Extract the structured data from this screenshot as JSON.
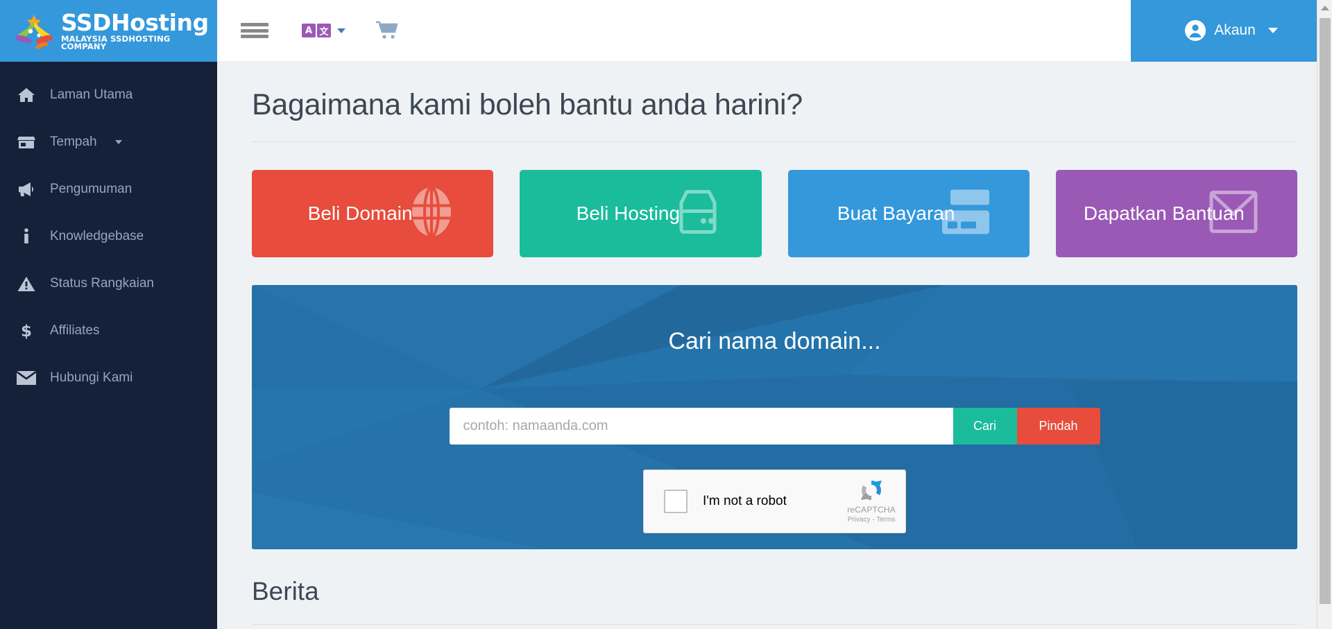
{
  "brand": {
    "name": "SSDHosting",
    "tagline": "MALAYSIA SSDHOSTING COMPANY",
    "logo_icon": "star-burst-logo-icon",
    "header_color": "#3498db"
  },
  "sidebar": {
    "background_color": "#152039",
    "items": [
      {
        "label": "Laman Utama",
        "icon": "home-icon",
        "has_caret": false
      },
      {
        "label": "Tempah",
        "icon": "store-icon",
        "has_caret": true
      },
      {
        "label": "Pengumuman",
        "icon": "megaphone-icon",
        "has_caret": false
      },
      {
        "label": "Knowledgebase",
        "icon": "info-icon",
        "has_caret": false
      },
      {
        "label": "Status Rangkaian",
        "icon": "warning-icon",
        "has_caret": false
      },
      {
        "label": "Affiliates",
        "icon": "dollar-icon",
        "has_caret": false
      },
      {
        "label": "Hubungi Kami",
        "icon": "envelope-icon",
        "has_caret": false
      }
    ]
  },
  "topbar": {
    "menu_toggle_icon": "hamburger-icon",
    "language_icon": "translate-icon",
    "language_glyph_left": "A",
    "language_glyph_right": "文",
    "cart_icon": "shopping-cart-icon",
    "account_label": "Akaun",
    "account_icon": "user-circle-icon",
    "account_color": "#3498db"
  },
  "main": {
    "page_title": "Bagaimana kami boleh bantu anda harini?",
    "cards": [
      {
        "label": "Beli Domain",
        "icon": "globe-icon",
        "color": "#e74c3c"
      },
      {
        "label": "Beli Hosting",
        "icon": "server-icon",
        "color": "#1abc9c"
      },
      {
        "label": "Buat Bayaran",
        "icon": "credit-card-icon",
        "color": "#3498db"
      },
      {
        "label": "Dapatkan Bantuan",
        "icon": "envelope-icon",
        "color": "#9b59b6"
      }
    ],
    "domain_search": {
      "title": "Cari nama domain...",
      "placeholder": "contoh: namaanda.com",
      "input_value": "",
      "search_button": "Cari",
      "transfer_button": "Pindah",
      "panel_color": "#2470a8",
      "search_button_color": "#1abc9c",
      "transfer_button_color": "#e74c3c"
    },
    "recaptcha": {
      "label": "I'm not a robot",
      "brand": "reCAPTCHA",
      "privacy": "Privacy",
      "separator": "-",
      "terms": "Terms",
      "checked": false
    },
    "news_title": "Berita"
  }
}
